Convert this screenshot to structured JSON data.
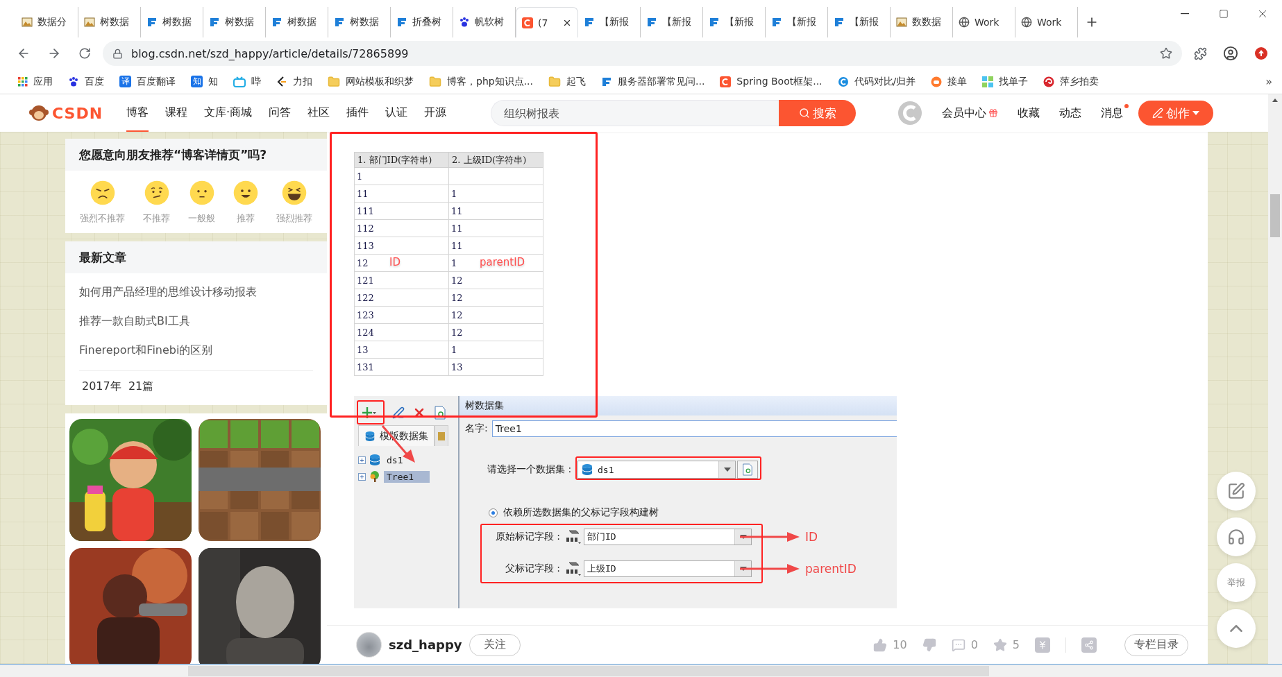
{
  "browser": {
    "tabs": [
      {
        "kind": "picture",
        "title": "数据分",
        "selected": false
      },
      {
        "kind": "picture",
        "title": "树数据",
        "selected": false
      },
      {
        "kind": "fanruan",
        "title": "树数据",
        "selected": false
      },
      {
        "kind": "fanruan",
        "title": "树数据",
        "selected": false
      },
      {
        "kind": "fanruan",
        "title": "树数据",
        "selected": false
      },
      {
        "kind": "fanruan",
        "title": "树数据",
        "selected": false
      },
      {
        "kind": "fanruan",
        "title": "折叠树",
        "selected": false
      },
      {
        "kind": "baidu",
        "title": "帆软树",
        "selected": false
      },
      {
        "kind": "csdn",
        "title": "(7",
        "selected": true
      },
      {
        "kind": "fanruan",
        "title": "【新报",
        "selected": false
      },
      {
        "kind": "fanruan",
        "title": "【新报",
        "selected": false
      },
      {
        "kind": "fanruan",
        "title": "【新报",
        "selected": false
      },
      {
        "kind": "fanruan",
        "title": "【新报",
        "selected": false
      },
      {
        "kind": "fanruan",
        "title": "【新报",
        "selected": false
      },
      {
        "kind": "picture",
        "title": "数数据",
        "selected": false
      },
      {
        "kind": "globe",
        "title": "Work",
        "selected": false
      },
      {
        "kind": "globe",
        "title": "Work",
        "selected": false
      }
    ],
    "address": "blog.csdn.net/szd_happy/article/details/72865899",
    "bookmarks": [
      {
        "kind": "apps",
        "label": "应用"
      },
      {
        "kind": "paw",
        "label": "百度"
      },
      {
        "kind": "badge",
        "badge": "译",
        "label": "百度翻译"
      },
      {
        "kind": "badge",
        "badge": "知",
        "label": "知"
      },
      {
        "kind": "tv",
        "label": "哔"
      },
      {
        "kind": "leetcode",
        "label": "力扣"
      },
      {
        "kind": "folder",
        "label": "网站模板和织梦"
      },
      {
        "kind": "folder",
        "label": "博客，php知识点..."
      },
      {
        "kind": "folder",
        "label": "起飞"
      },
      {
        "kind": "fanruan",
        "label": "服务器部署常见问..."
      },
      {
        "kind": "csdn",
        "label": "Spring Boot框架..."
      },
      {
        "kind": "ring",
        "label": "代码对比/归并"
      },
      {
        "kind": "orange",
        "label": "接单"
      },
      {
        "kind": "tiles",
        "label": "找单子"
      },
      {
        "kind": "swirl",
        "label": "萍乡拍卖"
      }
    ],
    "more": "»"
  },
  "header": {
    "logo": "CSDN",
    "nav": [
      {
        "label": "博客",
        "selected": true
      },
      {
        "label": "课程",
        "selected": false
      },
      {
        "label": "文库·商城",
        "selected": false
      },
      {
        "label": "问答",
        "selected": false
      },
      {
        "label": "社区",
        "selected": false
      },
      {
        "label": "插件",
        "selected": false
      },
      {
        "label": "认证",
        "selected": false
      },
      {
        "label": "开源",
        "selected": false
      }
    ],
    "search": {
      "placeholder": "组织树报表"
    },
    "search_button": "搜索",
    "links": [
      {
        "label": "会员中心",
        "kind": "gift",
        "notify": false
      },
      {
        "label": "收藏",
        "kind": "plain",
        "notify": false
      },
      {
        "label": "动态",
        "kind": "plain",
        "notify": false
      },
      {
        "label": "消息",
        "kind": "plain",
        "notify": true
      }
    ],
    "create_button": "创作"
  },
  "sidebar": {
    "recommend": {
      "title": "您愿意向朋友推荐“博客详情页”吗?",
      "options": [
        {
          "kind": "angry",
          "label": "强烈不推荐"
        },
        {
          "kind": "worried",
          "label": "不推荐"
        },
        {
          "kind": "neutral",
          "label": "一般般"
        },
        {
          "kind": "smile",
          "label": "推荐"
        },
        {
          "kind": "laugh",
          "label": "强烈推荐"
        }
      ]
    },
    "latest": {
      "title": "最新文章",
      "articles": [
        "如何用产品经理的思维设计移动报表",
        "推荐一款自助式BI工具",
        "Finereport和Finebi的区别"
      ],
      "archive": "2017年  21篇"
    }
  },
  "article": {
    "table": {
      "columns": [
        "1. 部门ID(字符串)",
        "2. 上级ID(字符串)"
      ],
      "rows": [
        {
          "cells": [
            "1"
          ]
        },
        {
          "cells": [
            "11",
            "1"
          ]
        },
        {
          "cells": [
            "111",
            "11"
          ]
        },
        {
          "cells": [
            "112",
            "11"
          ]
        },
        {
          "cells": [
            "113",
            "11"
          ]
        },
        {
          "cells": [
            "12",
            "1"
          ],
          "notes": [
            "ID",
            "parentID"
          ]
        },
        {
          "cells": [
            "121",
            "12"
          ]
        },
        {
          "cells": [
            "122",
            "12"
          ]
        },
        {
          "cells": [
            "123",
            "12"
          ]
        },
        {
          "cells": [
            "124",
            "12"
          ]
        },
        {
          "cells": [
            "13",
            "1"
          ]
        },
        {
          "cells": [
            "131",
            "13"
          ]
        }
      ]
    },
    "designer": {
      "panel_tab": "模版数据集",
      "tree": [
        {
          "kind": "database",
          "label": "ds1",
          "selected": false
        },
        {
          "kind": "tree",
          "label": "Tree1",
          "selected": true
        }
      ],
      "dialog": {
        "title": "树数据集",
        "name_label": "名字:",
        "name_value": "Tree1",
        "dataset_label": "请选择一个数据集 :",
        "dataset_value": "ds1",
        "radio": {
          "label": "依赖所选数据集的父标记字段构建树",
          "selected": true
        },
        "fields": [
          {
            "label": "原始标记字段 :",
            "value": "部门ID",
            "note": "ID"
          },
          {
            "label": "父标记字段 :",
            "value": "上级ID",
            "note": "parentID"
          }
        ]
      }
    }
  },
  "footer": {
    "author": "szd_happy",
    "follow": "关注",
    "actions": [
      {
        "kind": "like",
        "count": "10"
      },
      {
        "kind": "dislike"
      },
      {
        "kind": "comment",
        "count": "0"
      },
      {
        "kind": "star",
        "count": "5"
      },
      {
        "kind": "reward"
      }
    ],
    "toc": "专栏目录"
  },
  "float_buttons": [
    {
      "kind": "edit"
    },
    {
      "kind": "support"
    },
    {
      "kind": "text",
      "label": "举报"
    },
    {
      "kind": "top"
    }
  ]
}
